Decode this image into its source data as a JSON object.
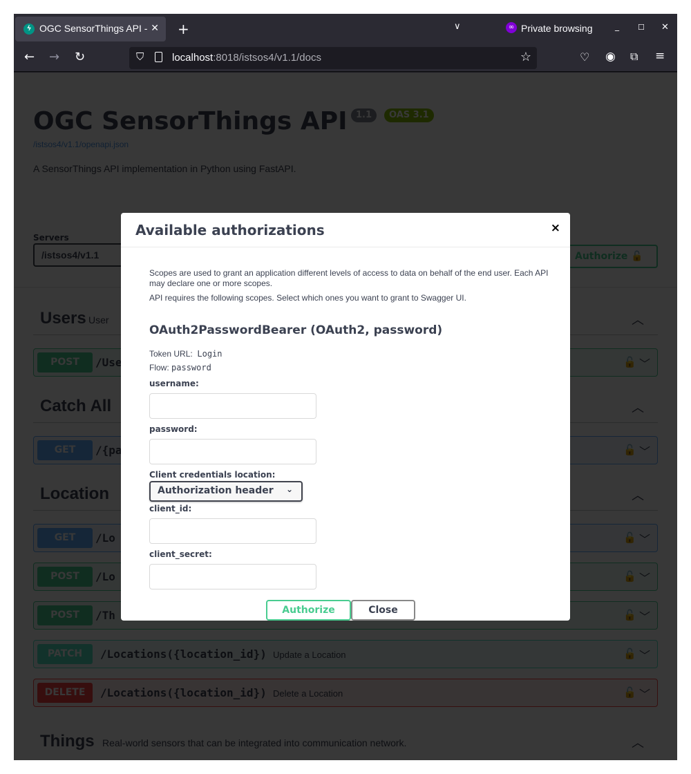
{
  "browser": {
    "tab_title": "OGC SensorThings API - ",
    "private_label": "Private browsing",
    "url_host": "localhost",
    "url_rest": ":8018/istsos4/v1.1/docs"
  },
  "page": {
    "title": "OGC SensorThings API",
    "version_badge": "1.1",
    "oas_badge": "OAS 3.1",
    "spec_link": "/istsos4/v1.1/openapi.json",
    "description": "A SensorThings API implementation in Python using FastAPI.",
    "servers_label": "Servers",
    "server_value": "/istsos4/v1.1",
    "authorize_label": "Authorize"
  },
  "sections": [
    {
      "name": "Users",
      "desc": "User"
    },
    {
      "name": "Catch All",
      "desc": ""
    },
    {
      "name": "Location",
      "desc": ""
    },
    {
      "name": "Things",
      "desc": "Real-world sensors that can be integrated into communication network."
    }
  ],
  "operations": [
    {
      "method": "POST",
      "path": "/Use",
      "summary": ""
    },
    {
      "method": "GET",
      "path": "/{pa",
      "summary": ""
    },
    {
      "method": "GET",
      "path": "/Lo",
      "summary": ""
    },
    {
      "method": "POST",
      "path": "/Lo",
      "summary": ""
    },
    {
      "method": "POST",
      "path": "/Th",
      "summary": ""
    },
    {
      "method": "PATCH",
      "path": "/Locations({location_id})",
      "summary": "Update a Location"
    },
    {
      "method": "DELETE",
      "path": "/Locations({location_id})",
      "summary": "Delete a Location"
    }
  ],
  "colors": {
    "post": "#49cc90",
    "get": "#61affe",
    "patch": "#50e3c2",
    "delete": "#f93e3e"
  },
  "modal": {
    "title": "Available authorizations",
    "close_icon": "×",
    "scopes_text": "Scopes are used to grant an application different levels of access to data on behalf of the end user. Each API may declare one or more scopes.",
    "requires_text": "API requires the following scopes. Select which ones you want to grant to Swagger UI.",
    "scheme_title": "OAuth2PasswordBearer (OAuth2, password)",
    "token_url_label": "Token URL:",
    "token_url": "Login",
    "flow_label": "Flow:",
    "flow": "password",
    "username_label": "username:",
    "password_label": "password:",
    "client_loc_label": "Client credentials location:",
    "client_loc_value": "Authorization header",
    "client_id_label": "client_id:",
    "client_secret_label": "client_secret:",
    "authorize_button": "Authorize",
    "close_button": "Close"
  }
}
